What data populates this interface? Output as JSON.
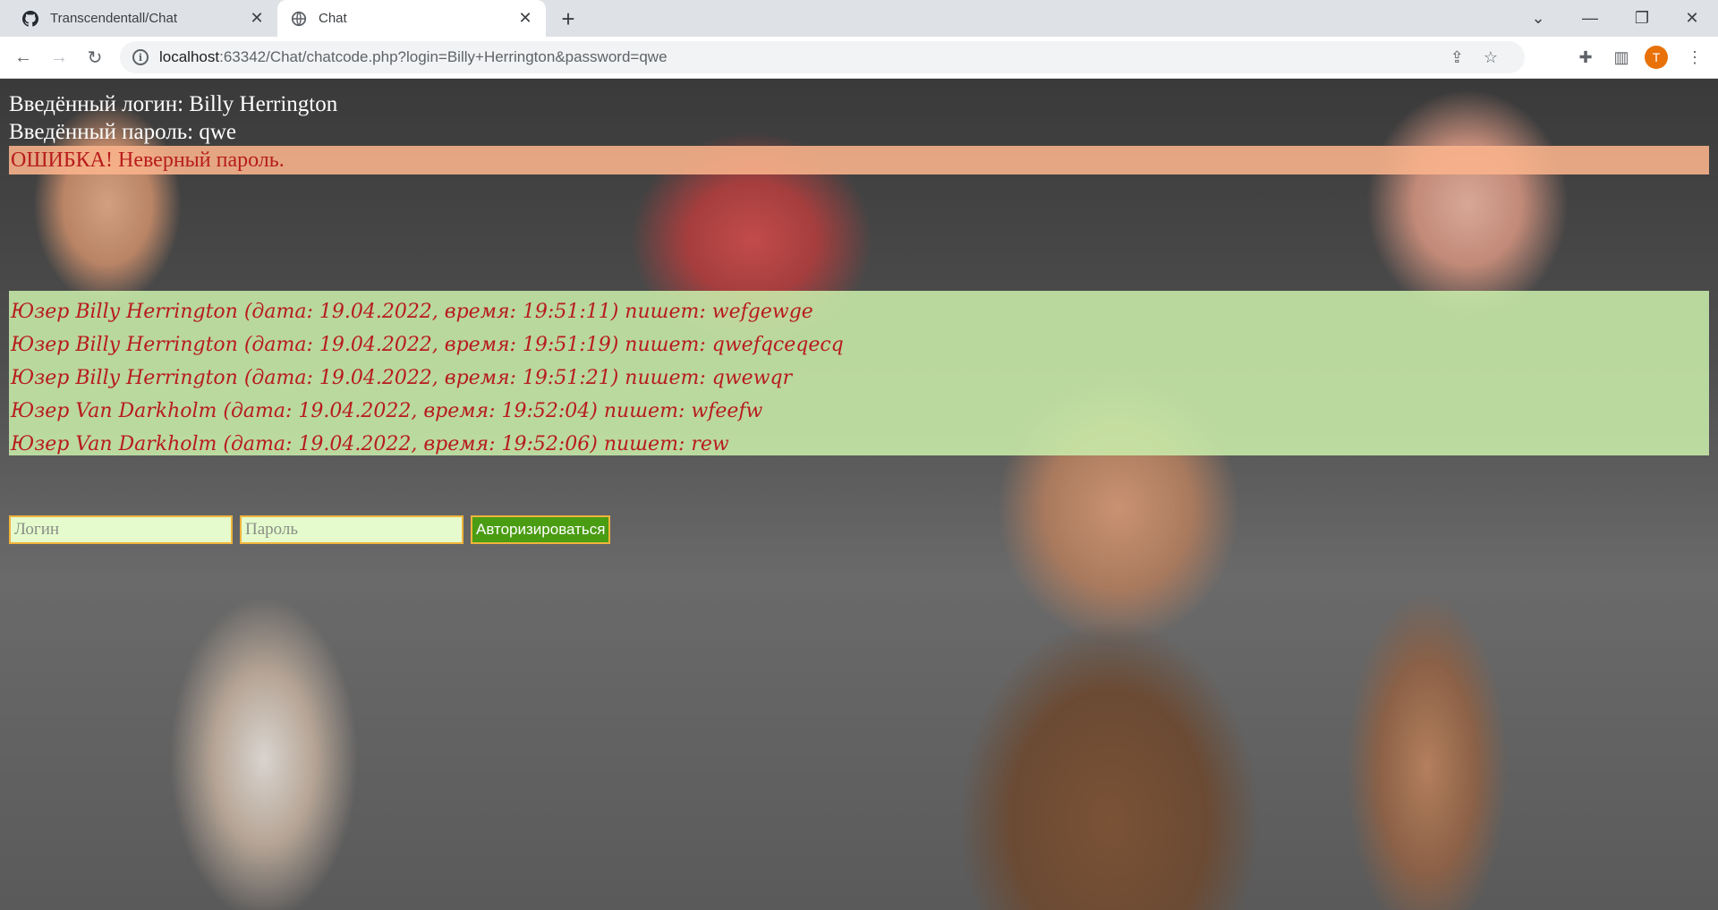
{
  "browser": {
    "tabs": [
      {
        "title": "Transcendentall/Chat",
        "icon": "github-icon",
        "active": false
      },
      {
        "title": "Chat",
        "icon": "globe-icon",
        "active": true
      }
    ],
    "url_host": "localhost",
    "url_rest": ":63342/Chat/chatcode.php?login=Billy+Herrington&password=qwe",
    "profile_initial": "T",
    "profile_color": "#e8710a"
  },
  "page": {
    "login_line": "Введённый логин: Billy Herrington",
    "password_line": "Введённый пароль: qwe",
    "error_message": "ОШИБКА! Неверный пароль.",
    "messages": [
      "Юзер Billy Herrington (дата: 19.04.2022, время: 19:51:11) пишет: wefgewge",
      "Юзер Billy Herrington (дата: 19.04.2022, время: 19:51:19) пишет: qwefqceqecq",
      "Юзер Billy Herrington (дата: 19.04.2022, время: 19:51:21) пишет: qwewqr",
      "Юзер Van Darkholm (дата: 19.04.2022, время: 19:52:04) пишет: wfeefw",
      "Юзер Van Darkholm (дата: 19.04.2022, время: 19:52:06) пишет: rew"
    ],
    "login_form": {
      "login_placeholder": "Логин",
      "password_placeholder": "Пароль",
      "submit_label": "Авторизироваться"
    }
  },
  "colors": {
    "error_text": "#b71c1c",
    "error_background": "#fab48c",
    "chat_background": "#c8eca9",
    "input_background": "#e5fbcd",
    "input_border": "#f0b43c",
    "button_background": "#4a9c12"
  }
}
